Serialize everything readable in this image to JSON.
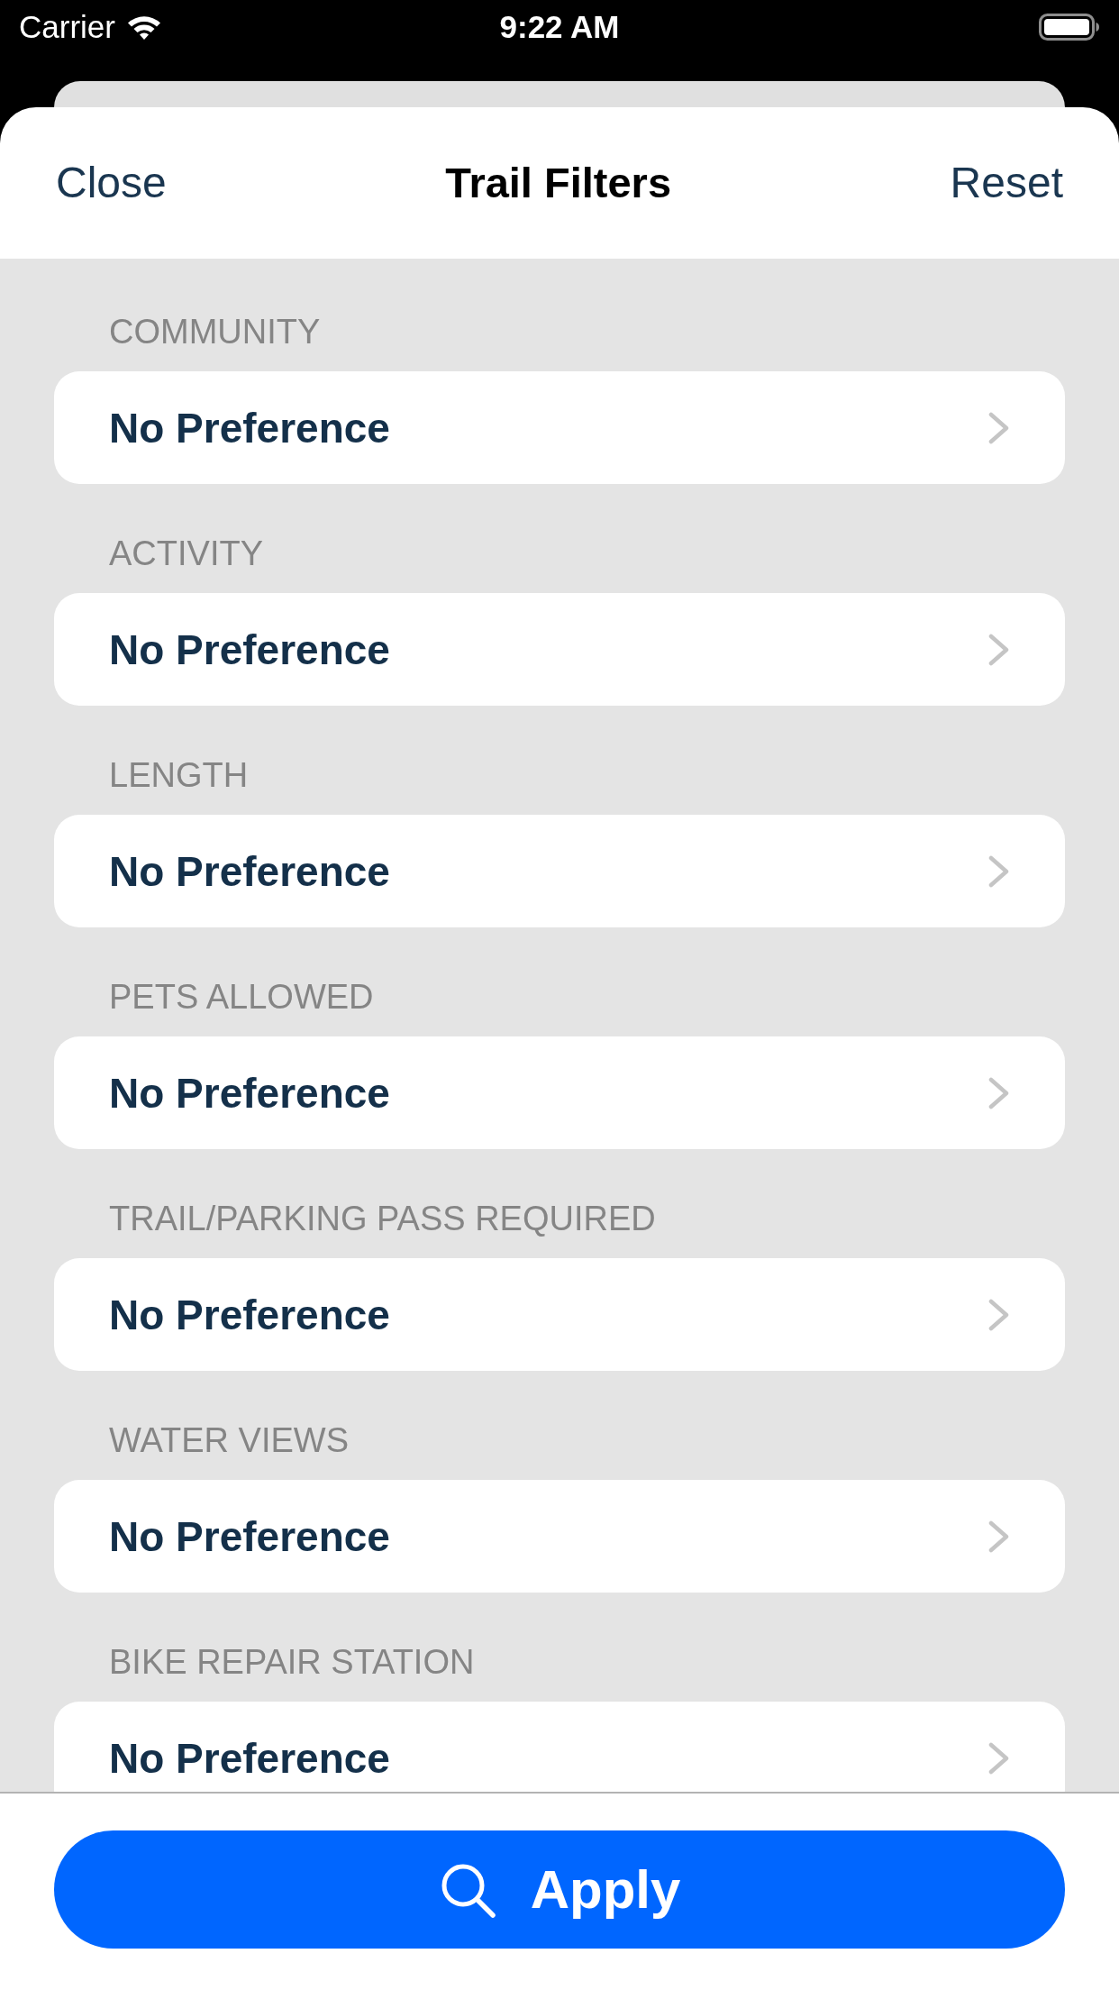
{
  "status_bar": {
    "carrier": "Carrier",
    "time": "9:22 AM"
  },
  "header": {
    "close": "Close",
    "title": "Trail Filters",
    "reset": "Reset"
  },
  "filters": [
    {
      "label": "COMMUNITY",
      "value": "No Preference"
    },
    {
      "label": "ACTIVITY",
      "value": "No Preference"
    },
    {
      "label": "LENGTH",
      "value": "No Preference"
    },
    {
      "label": "PETS ALLOWED",
      "value": "No Preference"
    },
    {
      "label": "TRAIL/PARKING PASS REQUIRED",
      "value": "No Preference"
    },
    {
      "label": "WATER VIEWS",
      "value": "No Preference"
    },
    {
      "label": "BIKE REPAIR STATION",
      "value": "No Preference"
    }
  ],
  "apply_button": {
    "label": "Apply"
  }
}
